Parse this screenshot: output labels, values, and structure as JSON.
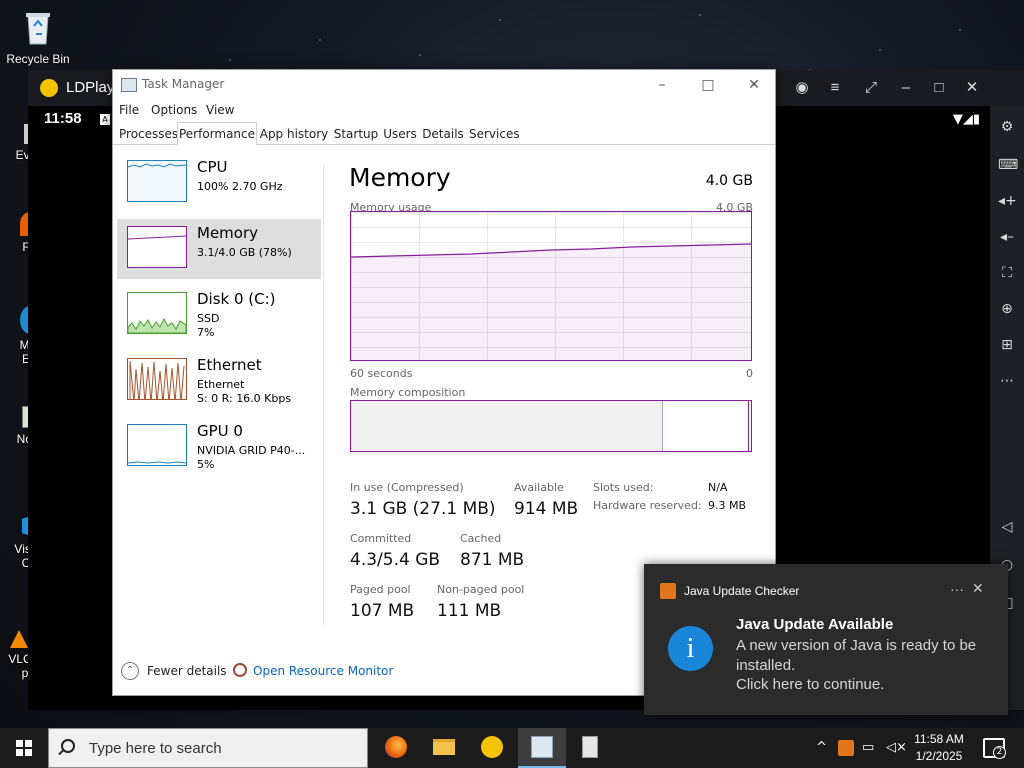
{
  "desktop": {
    "icons": [
      {
        "label": "Recycle Bin"
      },
      {
        "label": "Eve"
      },
      {
        "label": "F"
      },
      {
        "label": "Mi\nE"
      },
      {
        "label": "Not"
      },
      {
        "label": "Visu\nC"
      },
      {
        "label": "VLC media player"
      }
    ]
  },
  "ldplayer": {
    "title": "LDPlay",
    "android_time": "11:58",
    "android_a": "A"
  },
  "taskmanager": {
    "title": "Task Manager",
    "menu": [
      "File",
      "Options",
      "View"
    ],
    "tabs": [
      "Processes",
      "Performance",
      "App history",
      "Startup",
      "Users",
      "Details",
      "Services"
    ],
    "active_tab": "Performance",
    "resources": [
      {
        "name": "CPU",
        "sub1": "100%  2.70 GHz",
        "sub2": "",
        "color": "#1f7fbf"
      },
      {
        "name": "Memory",
        "sub1": "3.1/4.0 GB (78%)",
        "sub2": "",
        "color": "#8a1b9c",
        "selected": true
      },
      {
        "name": "Disk 0 (C:)",
        "sub1": "SSD",
        "sub2": "7%",
        "color": "#4aa02c"
      },
      {
        "name": "Ethernet",
        "sub1": "Ethernet",
        "sub2": "S: 0  R: 16.0 Kbps",
        "color": "#a8542c"
      },
      {
        "name": "GPU 0",
        "sub1": "NVIDIA GRID P40-...",
        "sub2": "5%",
        "color": "#1f7fbf"
      }
    ],
    "detail": {
      "title": "Memory",
      "total": "4.0 GB",
      "usage_label": "Memory usage",
      "usage_max": "4.0 GB",
      "time_left": "60 seconds",
      "time_right": "0",
      "composition_label": "Memory composition",
      "in_use_label": "In use (Compressed)",
      "in_use_value": "3.1 GB (27.1 MB)",
      "available_label": "Available",
      "available_value": "914 MB",
      "committed_label": "Committed",
      "committed_value": "4.3/5.4 GB",
      "cached_label": "Cached",
      "cached_value": "871 MB",
      "paged_label": "Paged pool",
      "paged_value": "107 MB",
      "nonpaged_label": "Non-paged pool",
      "nonpaged_value": "111 MB",
      "slots_label": "Slots used:",
      "slots_value": "N/A",
      "hwres_label": "Hardware reserved:",
      "hwres_value": "9.3 MB",
      "usage_fraction": 0.78
    },
    "footer": {
      "fewer_details": "Fewer details",
      "open_monitor": "Open Resource Monitor"
    }
  },
  "notification": {
    "app": "Java Update Checker",
    "more": "···",
    "close": "✕",
    "heading": "Java Update Available",
    "body1": "A new version of Java is ready to be installed.",
    "body2": "Click here to continue.",
    "icon_glyph": "i"
  },
  "taskbar": {
    "search_placeholder": "Type here to search",
    "time": "11:58 AM",
    "date": "1/2/2025",
    "notif_count": "2"
  }
}
